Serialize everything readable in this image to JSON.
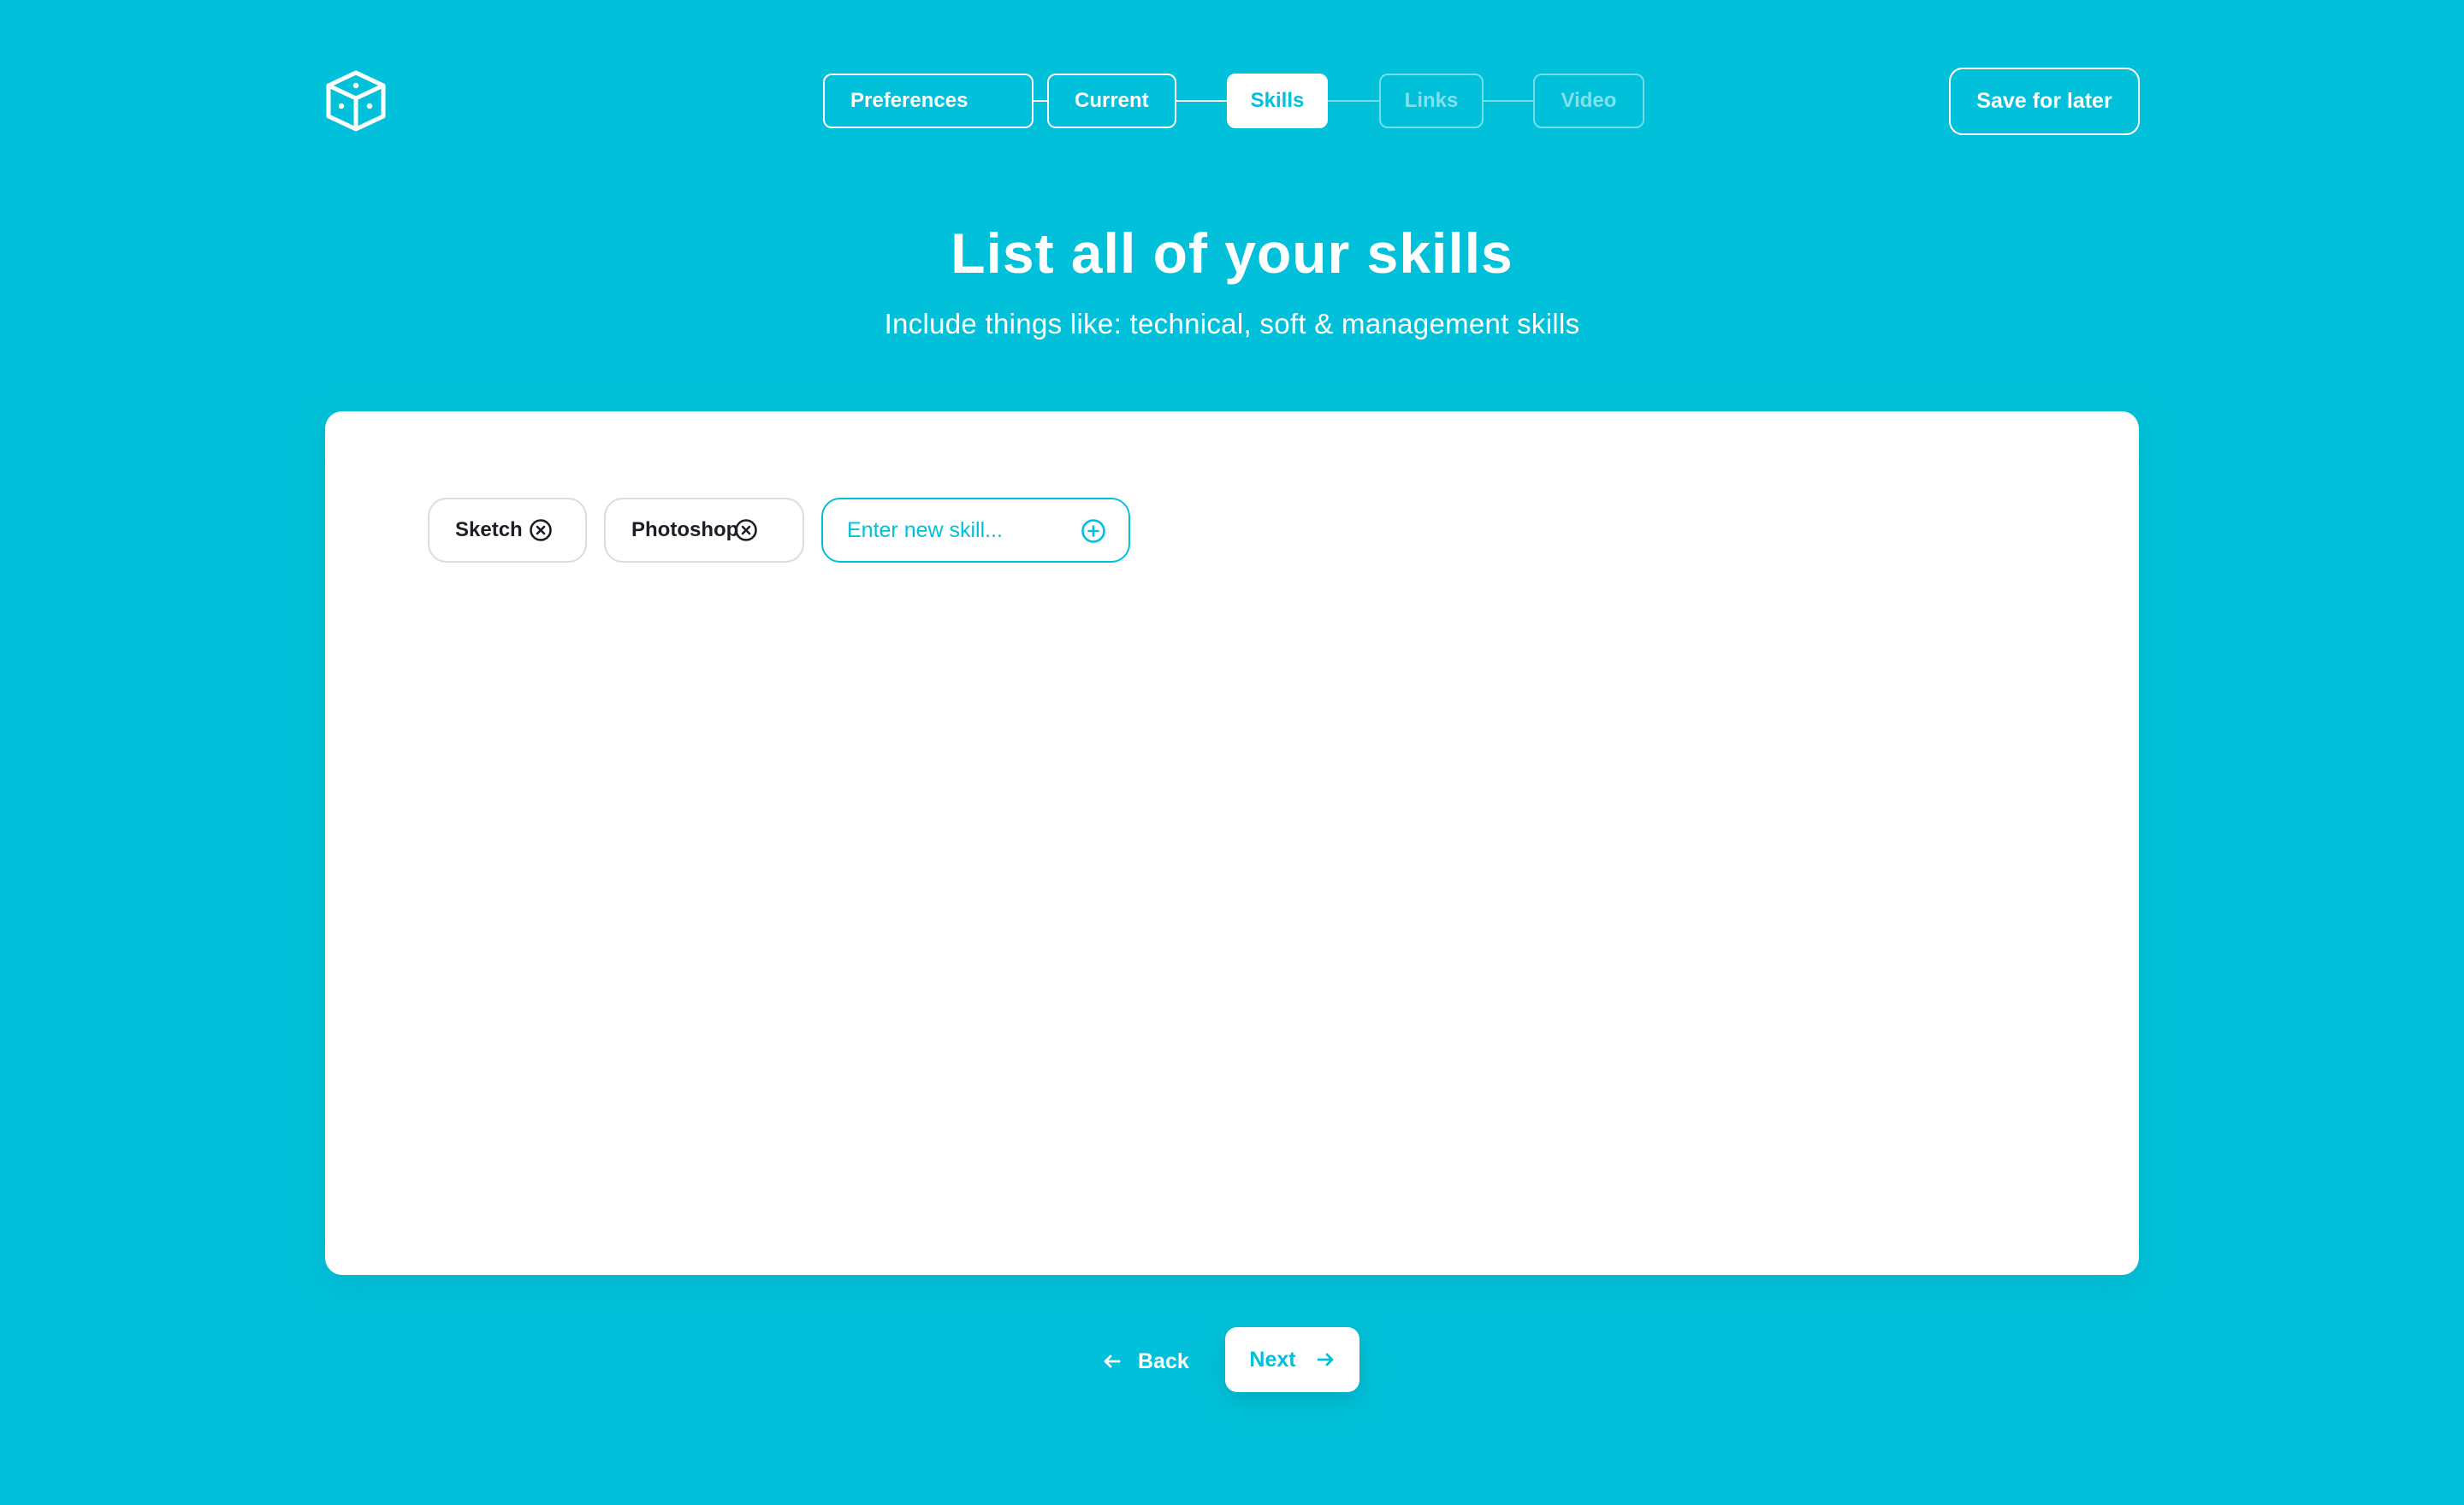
{
  "header": {
    "logo_icon": "cube-icon",
    "steps": [
      {
        "label": "Preferences",
        "state": "done"
      },
      {
        "label": "Current",
        "state": "done"
      },
      {
        "label": "Skills",
        "state": "active"
      },
      {
        "label": "Links",
        "state": "future"
      },
      {
        "label": "Video",
        "state": "future"
      }
    ],
    "save_label": "Save for later"
  },
  "main": {
    "title": "List all of your skills",
    "subtitle": "Include things like: technical, soft & management skills",
    "skills": [
      {
        "label": "Sketch",
        "remove_icon": "close-circle-icon"
      },
      {
        "label": "Photoshop",
        "remove_icon": "close-circle-icon"
      }
    ],
    "new_skill": {
      "value": "",
      "placeholder": "Enter new skill...",
      "add_icon": "plus-circle-icon"
    }
  },
  "footer": {
    "back_label": "Back",
    "next_label": "Next"
  },
  "colors": {
    "background": "#00C1D9",
    "card": "#FFFFFF",
    "accent": "#00C1D9",
    "chip_text": "#1B1E24"
  }
}
